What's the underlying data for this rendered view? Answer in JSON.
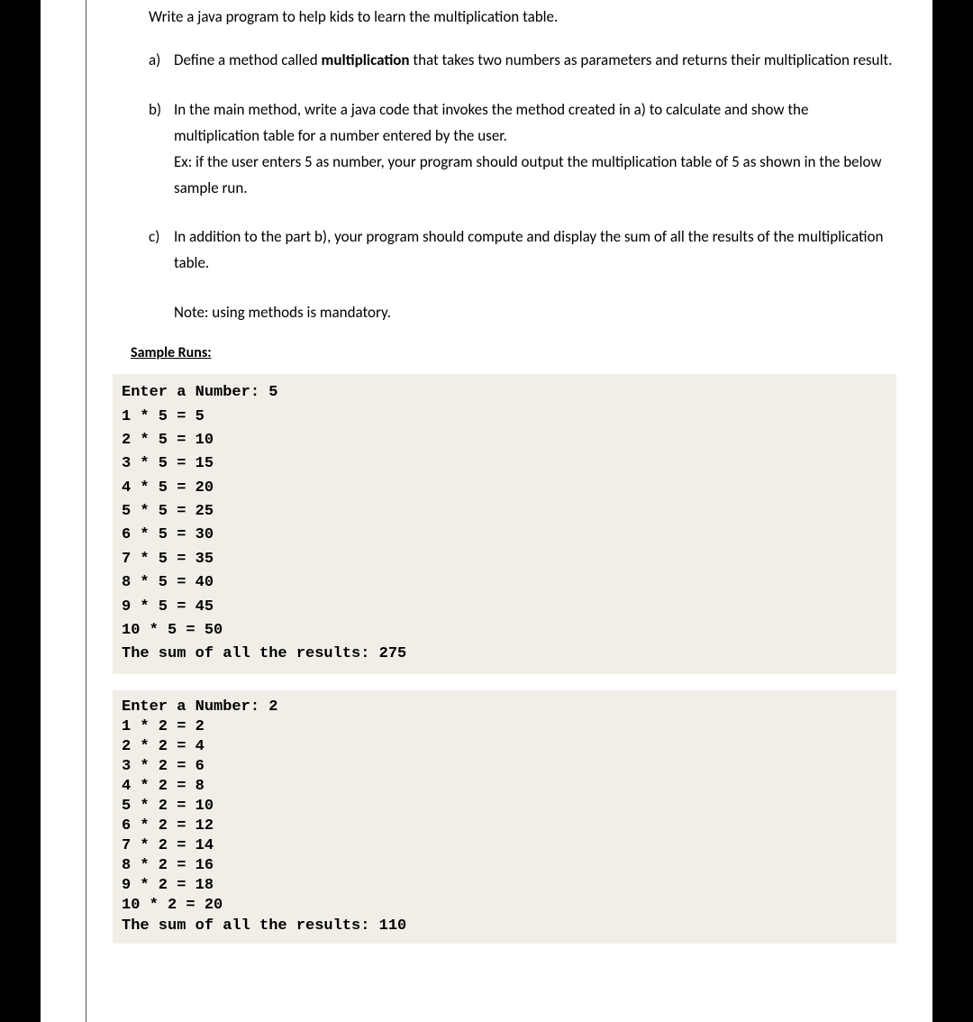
{
  "intro": "Write a java program to help kids to learn the multiplication table.",
  "items": {
    "a": {
      "label": "a)",
      "text_before": "Define a method called ",
      "bold": "multiplication",
      "text_after": " that takes two numbers as parameters and returns their multiplication result."
    },
    "b": {
      "label": "b)",
      "line1": "In the main method, write a java code that invokes the method created in a) to calculate and show the multiplication table for a number entered by the user.",
      "line2": "Ex: if the user enters 5 as number, your program should output the multiplication table of 5 as shown in the below sample run."
    },
    "c": {
      "label": "c)",
      "text": "In addition to the part b), your program should compute and display the sum of all the results of the multiplication table."
    }
  },
  "note": "Note: using methods is mandatory.",
  "sample_heading": "Sample Runs:",
  "run1": "Enter a Number: 5\n1 * 5 = 5\n2 * 5 = 10\n3 * 5 = 15\n4 * 5 = 20\n5 * 5 = 25\n6 * 5 = 30\n7 * 5 = 35\n8 * 5 = 40\n9 * 5 = 45\n10 * 5 = 50\nThe sum of all the results: 275",
  "run2": "Enter a Number: 2\n1 * 2 = 2\n2 * 2 = 4\n3 * 2 = 6\n4 * 2 = 8\n5 * 2 = 10\n6 * 2 = 12\n7 * 2 = 14\n8 * 2 = 16\n9 * 2 = 18\n10 * 2 = 20\nThe sum of all the results: 110"
}
